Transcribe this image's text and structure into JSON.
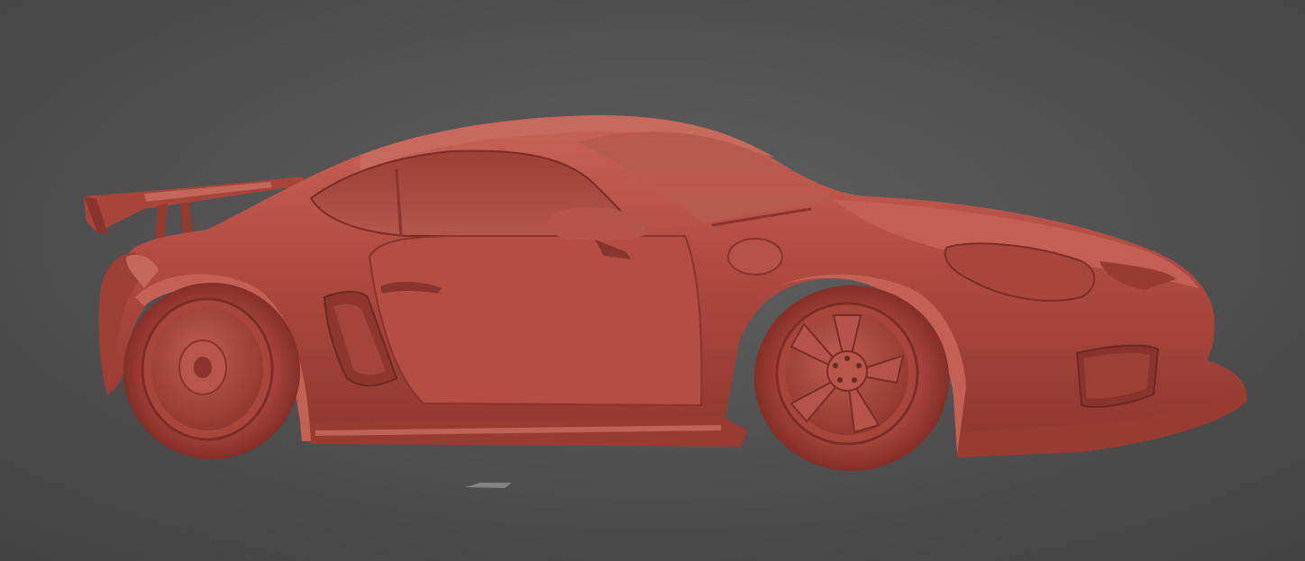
{
  "viewport": {
    "background_center": "#5f5f5f",
    "background_edge": "#434343"
  },
  "model": {
    "material_color": "#b04a40",
    "shadow_color": "#8a342d",
    "highlight_color": "#c96a5f",
    "dark_color": "#6e2923"
  }
}
